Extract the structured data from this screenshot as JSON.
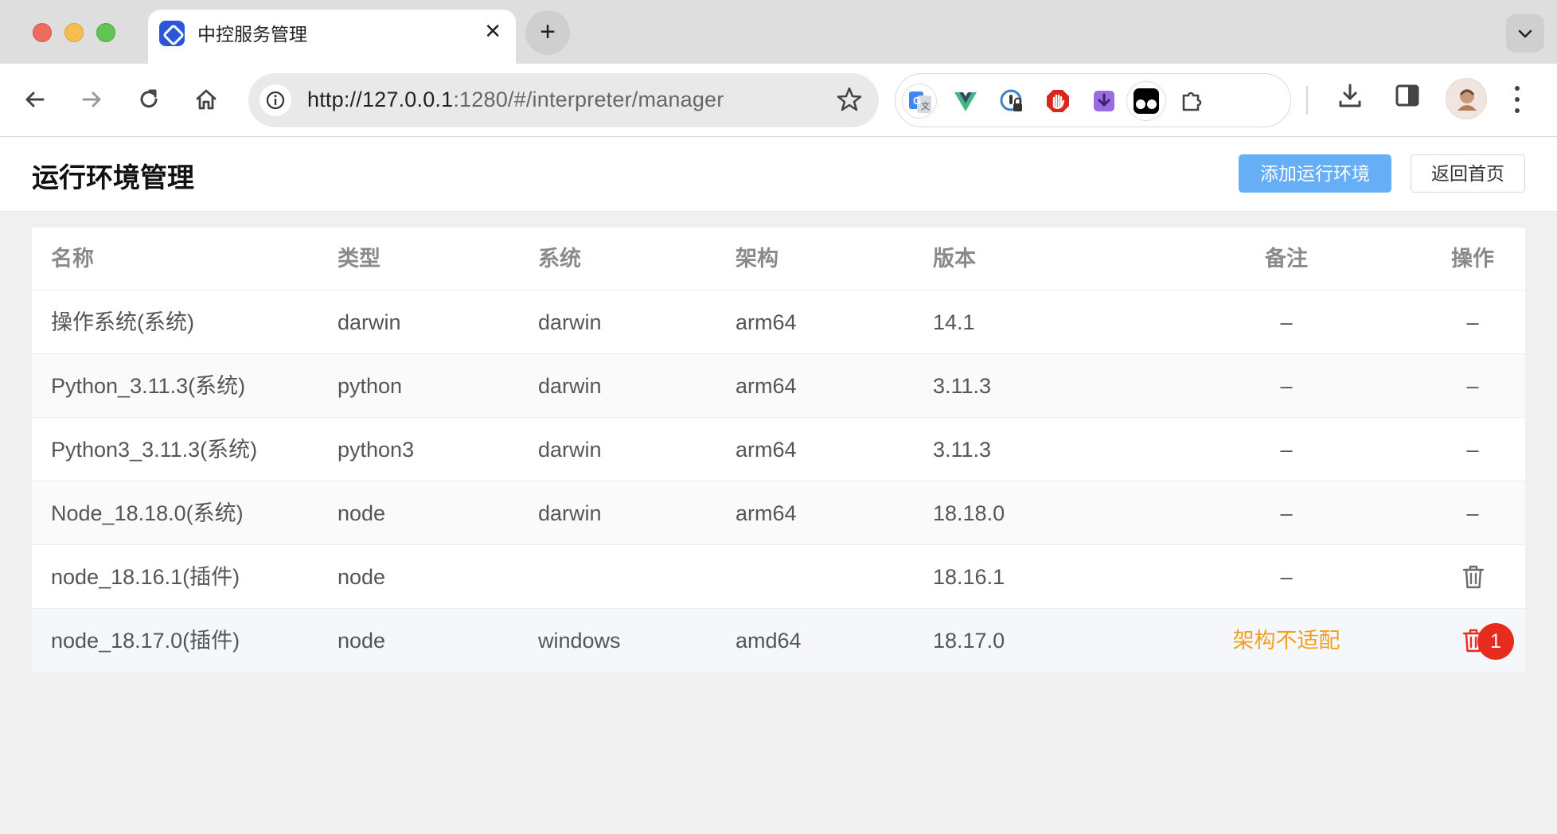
{
  "browser": {
    "tab_title": "中控服务管理",
    "url_host": "http://127.0.0.1",
    "url_rest": ":1280/#/interpreter/manager"
  },
  "header": {
    "title": "运行环境管理",
    "add_button": "添加运行环境",
    "home_button": "返回首页"
  },
  "table": {
    "columns": [
      "名称",
      "类型",
      "系统",
      "架构",
      "版本",
      "备注",
      "操作"
    ],
    "rows": [
      {
        "name": "操作系统(系统)",
        "type": "darwin",
        "system": "darwin",
        "arch": "arm64",
        "version": "14.1",
        "note": "–",
        "op": "–"
      },
      {
        "name": "Python_3.11.3(系统)",
        "type": "python",
        "system": "darwin",
        "arch": "arm64",
        "version": "3.11.3",
        "note": "–",
        "op": "–"
      },
      {
        "name": "Python3_3.11.3(系统)",
        "type": "python3",
        "system": "darwin",
        "arch": "arm64",
        "version": "3.11.3",
        "note": "–",
        "op": "–"
      },
      {
        "name": "Node_18.18.0(系统)",
        "type": "node",
        "system": "darwin",
        "arch": "arm64",
        "version": "18.18.0",
        "note": "–",
        "op": "–"
      },
      {
        "name": "node_18.16.1(插件)",
        "type": "node",
        "system": "",
        "arch": "",
        "version": "18.16.1",
        "note": "–",
        "op": "delete"
      },
      {
        "name": "node_18.17.0(插件)",
        "type": "node",
        "system": "windows",
        "arch": "amd64",
        "version": "18.17.0",
        "note": "架构不适配",
        "op": "delete"
      }
    ],
    "badge": "1"
  },
  "colors": {
    "primary": "#66aef5",
    "warning": "#f0a020",
    "danger": "#e62c1f"
  },
  "icons": [
    "back-arrow-icon",
    "forward-arrow-icon",
    "reload-icon",
    "home-icon",
    "info-icon",
    "star-icon",
    "google-translate-icon",
    "vue-devtools-icon",
    "password-manager-icon",
    "adblock-icon",
    "downloader-icon",
    "tampermonkey-icon",
    "extensions-puzzle-icon",
    "download-icon",
    "side-panel-icon",
    "profile-avatar",
    "menu-kebab-icon",
    "trash-icon"
  ]
}
